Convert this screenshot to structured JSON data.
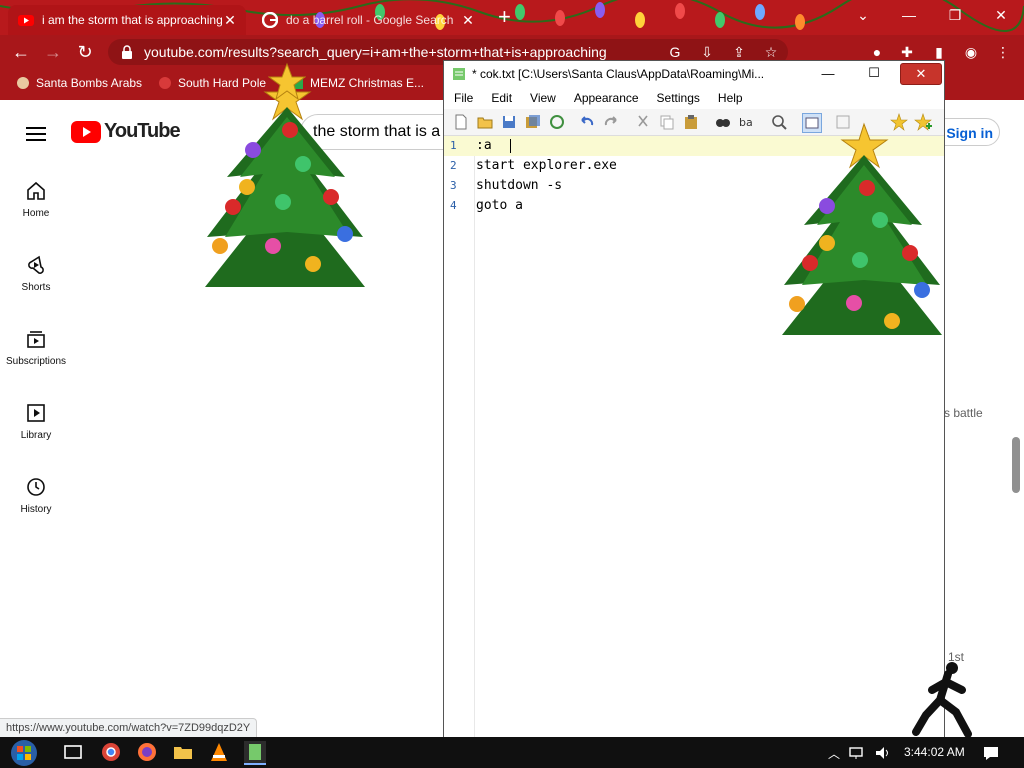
{
  "chrome": {
    "tabs": [
      {
        "title": "i am the storm that is approaching",
        "active": true
      },
      {
        "title": "do a barrel roll - Google Search",
        "active": false
      }
    ],
    "address": "youtube.com/results?search_query=i+am+the+storm+that+is+approaching",
    "bookmarks": [
      "Santa Bombs Arabs",
      "South Hard Pole",
      "MEMZ Christmas E..."
    ],
    "theme_color": "#b8191c"
  },
  "youtube": {
    "logo_text": "YouTube",
    "search_value": "the storm that is a",
    "sign_in": "Sign in",
    "sidebar": [
      {
        "label": "Home",
        "icon": "home-icon"
      },
      {
        "label": "Shorts",
        "icon": "shorts-icon"
      },
      {
        "label": "Subscriptions",
        "icon": "subscriptions-icon"
      },
      {
        "label": "Library",
        "icon": "library-icon"
      },
      {
        "label": "History",
        "icon": "history-icon"
      }
    ],
    "visible_fragments": {
      "right_text": "s battle",
      "bottom_text": "1st"
    }
  },
  "notepad": {
    "title": "* cok.txt [C:\\Users\\Santa Claus\\AppData\\Roaming\\Mi...",
    "menu": [
      "File",
      "Edit",
      "View",
      "Appearance",
      "Settings",
      "Help"
    ],
    "lines": [
      {
        "num": "1",
        "text": ":a"
      },
      {
        "num": "2",
        "text": "start explorer.exe"
      },
      {
        "num": "3",
        "text": "shutdown -s"
      },
      {
        "num": "4",
        "text": "goto a"
      }
    ]
  },
  "status_url": "https://www.youtube.com/watch?v=7ZD99dqzD2Y",
  "taskbar": {
    "clock": "3:44:02 AM"
  }
}
